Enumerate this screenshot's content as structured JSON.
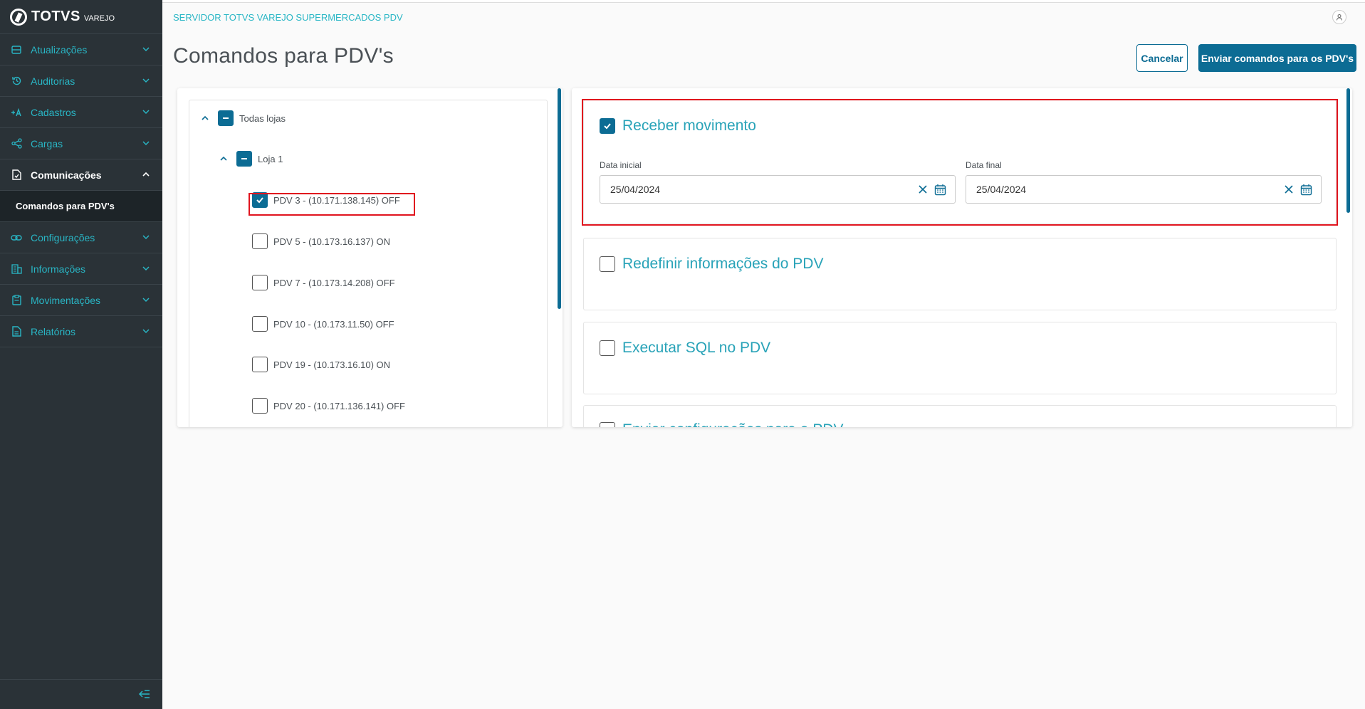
{
  "app": {
    "brand": "TOTVS",
    "brand_sub": "VAREJO"
  },
  "sidebar": {
    "items": [
      {
        "label": "Atualizações",
        "icon": "server-icon"
      },
      {
        "label": "Auditorias",
        "icon": "history-icon"
      },
      {
        "label": "Cadastros",
        "icon": "add-user-icon"
      },
      {
        "label": "Cargas",
        "icon": "share-icon"
      },
      {
        "label": "Comunicações",
        "icon": "document-icon"
      },
      {
        "label": "Configurações",
        "icon": "link-icon"
      },
      {
        "label": "Informações",
        "icon": "building-icon"
      },
      {
        "label": "Movimentações",
        "icon": "clipboard-icon"
      },
      {
        "label": "Relatórios",
        "icon": "report-icon"
      }
    ],
    "active_sub": "Comandos para PDV's"
  },
  "header": {
    "breadcrumb": "SERVIDOR TOTVS VAREJO SUPERMERCADOS PDV",
    "title": "Comandos para PDV's",
    "cancel_label": "Cancelar",
    "send_label": "Enviar comandos para os PDV's"
  },
  "tree": {
    "root_label": "Todas lojas",
    "store_label": "Loja 1",
    "pdvs": [
      {
        "label": "PDV 3 - (10.171.138.145) OFF",
        "checked": true
      },
      {
        "label": "PDV 5 - (10.173.16.137) ON",
        "checked": false
      },
      {
        "label": "PDV 7 - (10.173.14.208) OFF",
        "checked": false
      },
      {
        "label": "PDV 10 - (10.173.11.50) OFF",
        "checked": false
      },
      {
        "label": "PDV 19 - (10.173.16.10) ON",
        "checked": false
      },
      {
        "label": "PDV 20 - (10.171.136.141) OFF",
        "checked": false
      }
    ]
  },
  "commands": {
    "receber": {
      "title": "Receber movimento",
      "checked": true,
      "start_label": "Data inicial",
      "start_value": "25/04/2024",
      "end_label": "Data final",
      "end_value": "25/04/2024"
    },
    "redefinir": {
      "title": "Redefinir informações do PDV",
      "checked": false
    },
    "sql": {
      "title": "Executar SQL no PDV",
      "checked": false
    },
    "enviar": {
      "title": "Enviar configurações para o PDV",
      "checked": false
    }
  },
  "colors": {
    "primary": "#0c6c94",
    "accent": "#29b6c5",
    "sidebar": "#2a3237",
    "highlight": "#e0141e"
  }
}
